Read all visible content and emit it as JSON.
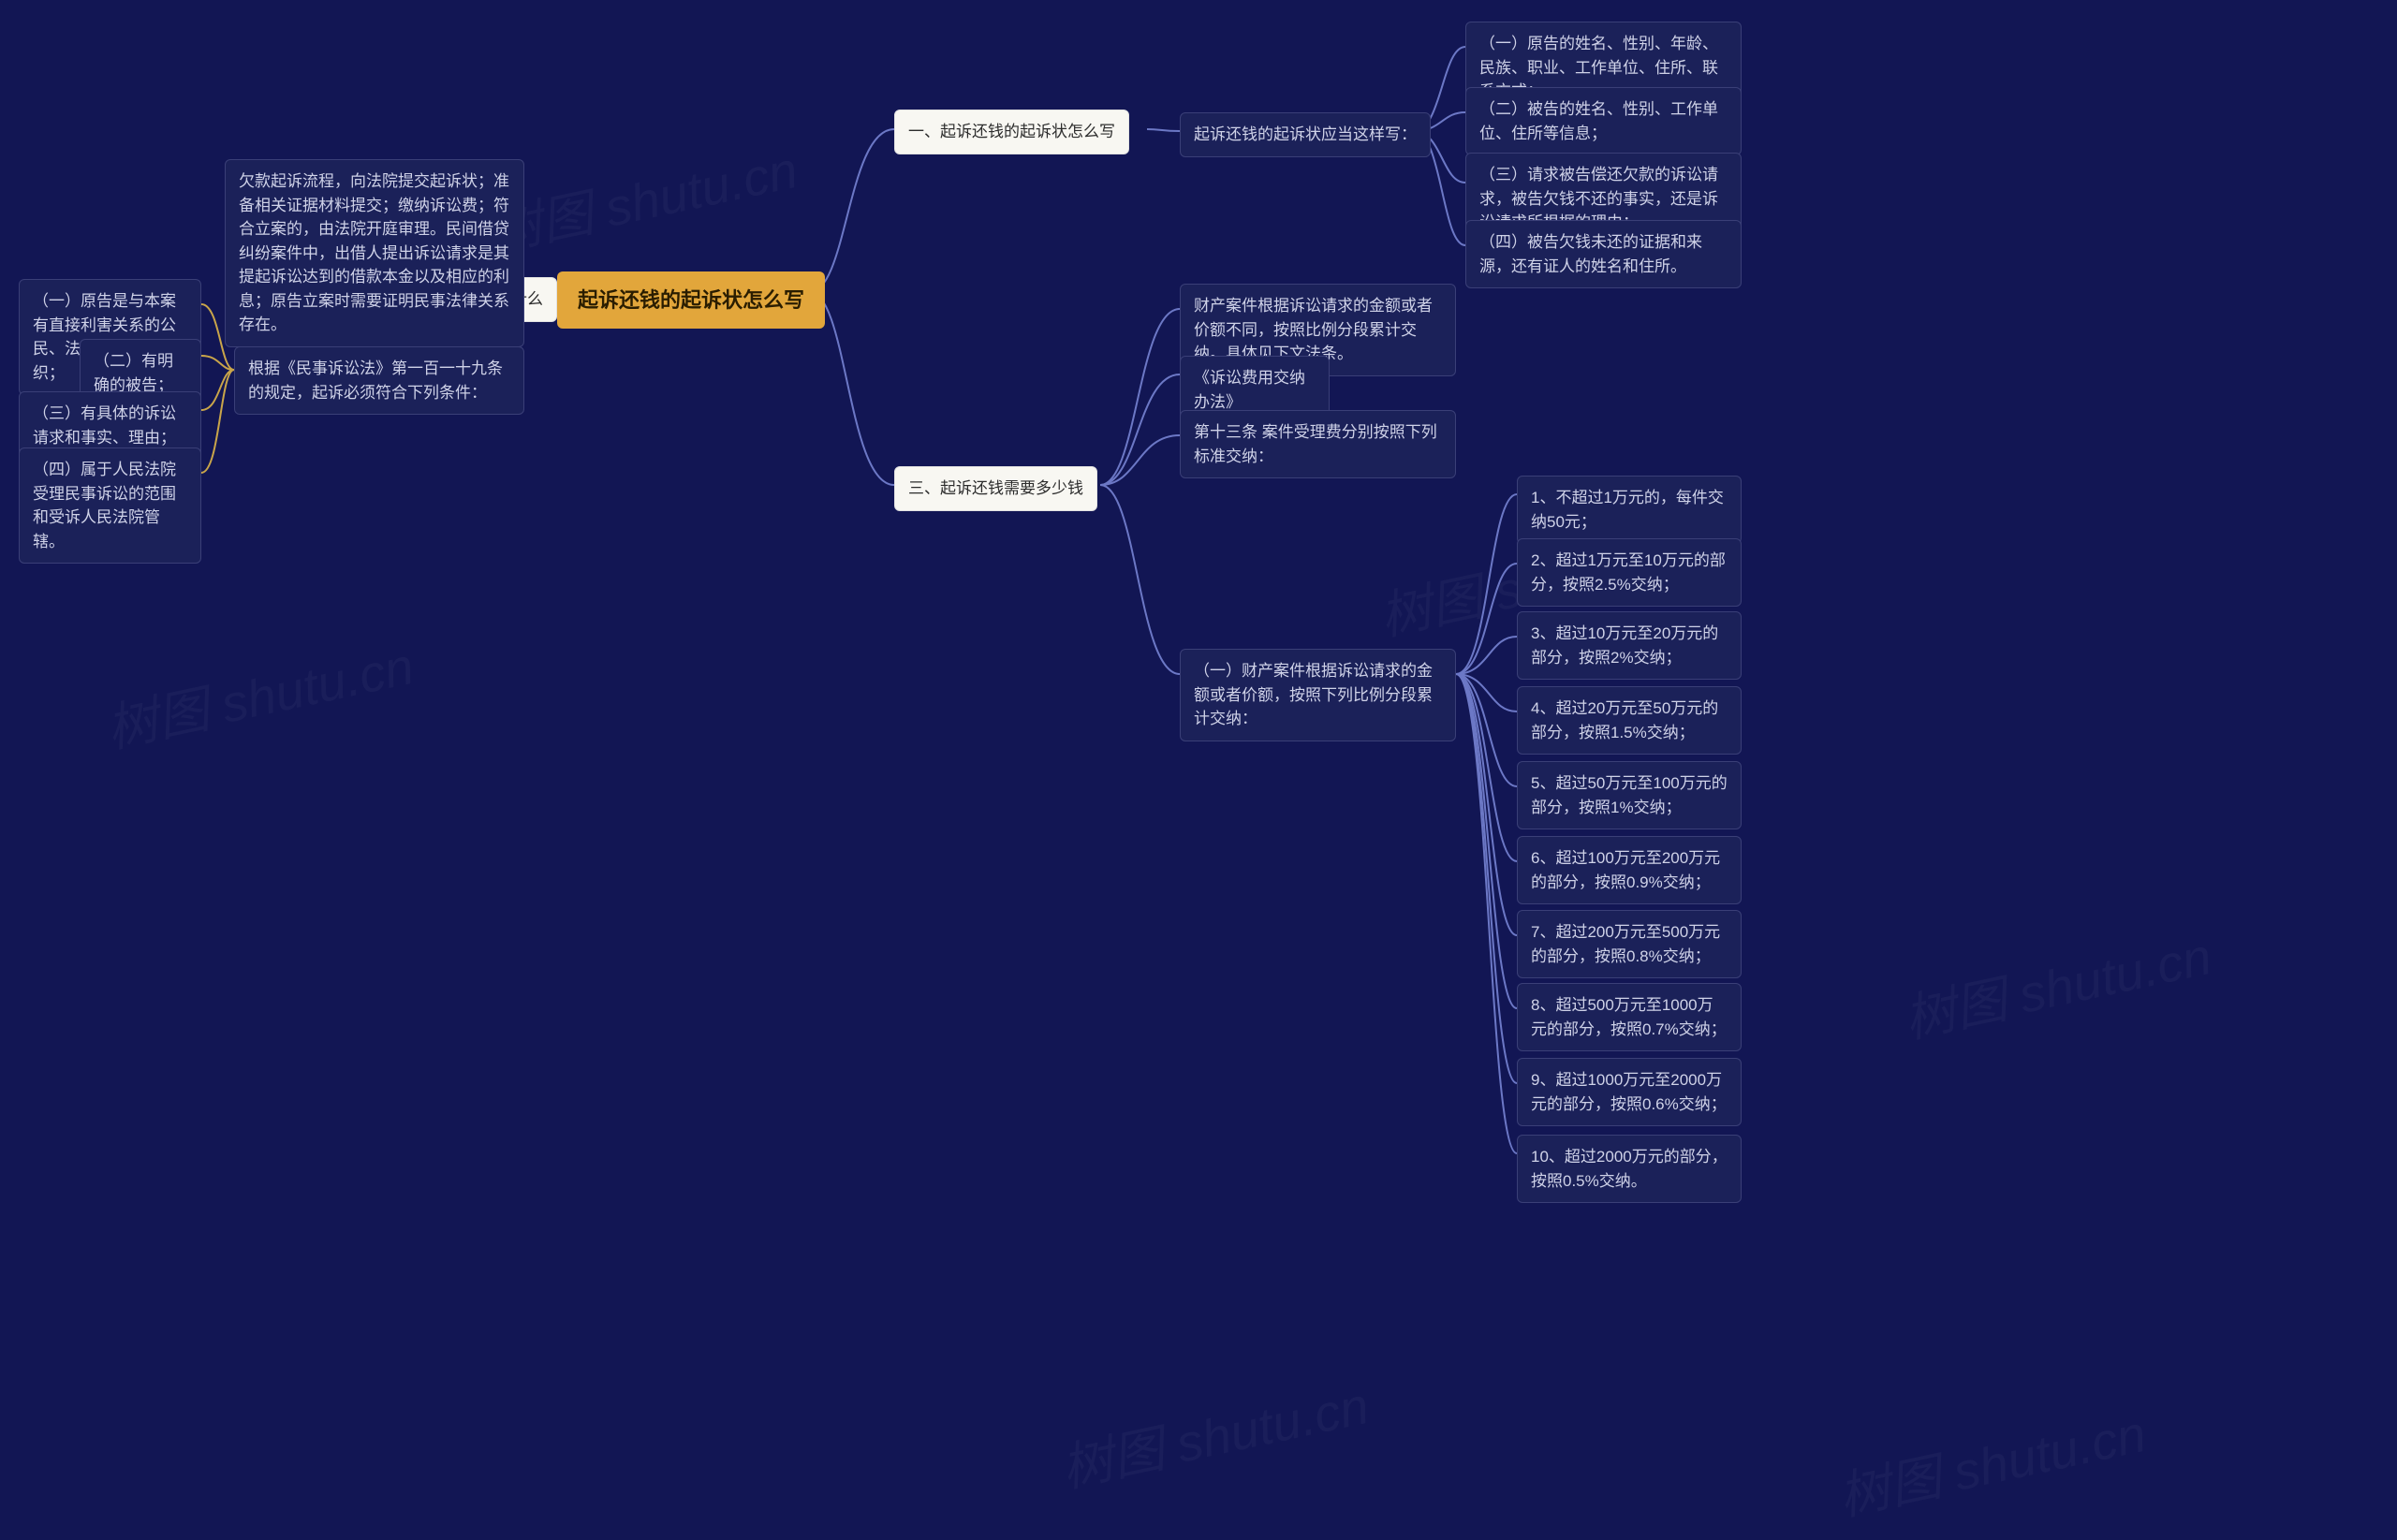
{
  "center": {
    "label": "起诉还钱的起诉状怎么写"
  },
  "branch1": {
    "label": "一、起诉还钱的起诉状怎么写",
    "sub": {
      "label": "起诉还钱的起诉状应当这样写："
    },
    "items": [
      "（一）原告的姓名、性别、年龄、民族、职业、工作单位、住所、联系方式；",
      "（二）被告的姓名、性别、工作单位、住所等信息；",
      "（三）请求被告偿还欠款的诉讼请求，被告欠钱不还的事实，还是诉讼请求所根据的理由；",
      "（四）被告欠钱未还的证据和来源，还有证人的姓名和住所。"
    ]
  },
  "branch2": {
    "label": "二、欠款起诉流程是什么",
    "block_a": "欠款起诉流程，向法院提交起诉状；准备相关证据材料提交；缴纳诉讼费；符合立案的，由法院开庭审理。民间借贷纠纷案件中，出借人提出诉讼请求是其提起诉讼达到的借款本金以及相应的利息；原告立案时需要证明民事法律关系存在。",
    "block_b": "根据《民事诉讼法》第一百一十九条的规定，起诉必须符合下列条件：",
    "conditions": [
      "（一）原告是与本案有直接利害关系的公民、法人和其他组织；",
      "（二）有明确的被告；",
      "（三）有具体的诉讼请求和事实、理由；",
      "（四）属于人民法院受理民事诉讼的范围和受诉人民法院管辖。"
    ]
  },
  "branch3": {
    "label": "三、起诉还钱需要多少钱",
    "intro_a": "财产案件根据诉讼请求的金额或者价额不同，按照比例分段累计交纳。具体见下文法条。",
    "intro_b": "《诉讼费用交纳办法》",
    "intro_c": "第十三条 案件受理费分别按照下列标准交纳：",
    "intro_d": "（一）财产案件根据诉讼请求的金额或者价额，按照下列比例分段累计交纳：",
    "fees": [
      "1、不超过1万元的，每件交纳50元；",
      "2、超过1万元至10万元的部分，按照2.5%交纳；",
      "3、超过10万元至20万元的部分，按照2%交纳；",
      "4、超过20万元至50万元的部分，按照1.5%交纳；",
      "5、超过50万元至100万元的部分，按照1%交纳；",
      "6、超过100万元至200万元的部分，按照0.9%交纳；",
      "7、超过200万元至500万元的部分，按照0.8%交纳；",
      "8、超过500万元至1000万元的部分，按照0.7%交纳；",
      "9、超过1000万元至2000万元的部分，按照0.6%交纳；",
      "10、超过2000万元的部分，按照0.5%交纳。"
    ]
  },
  "watermark": "树图 shutu.cn"
}
